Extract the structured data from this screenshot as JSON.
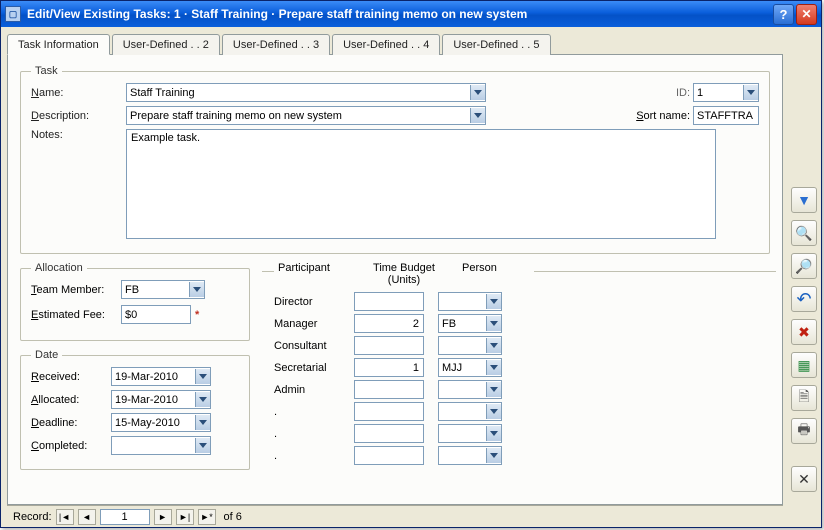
{
  "window": {
    "title": "Edit/View Existing Tasks:   1  ·  Staff Training  ·  Prepare staff training memo on new system"
  },
  "tabs": {
    "t0": "Task Information",
    "t1": "User-Defined . . 2",
    "t2": "User-Defined . . 3",
    "t3": "User-Defined . . 4",
    "t4": "User-Defined . . 5"
  },
  "task": {
    "legend": "Task",
    "name_label_u": "N",
    "name_label_rest": "ame:",
    "name_value": "Staff Training",
    "id_label": "ID:",
    "id_value": "1",
    "desc_label_u": "D",
    "desc_label_rest": "escription:",
    "desc_value": "Prepare staff training memo on new system",
    "sortname_label_u": "S",
    "sortname_label_rest": "ort name:",
    "sortname_value": "STAFFTRA",
    "notes_label": "Notes:",
    "notes_value": "Example task."
  },
  "allocation": {
    "legend": "Allocation",
    "team_label_u": "T",
    "team_label_rest": "eam Member:",
    "team_value": "FB",
    "fee_label_u": "E",
    "fee_label_rest": "stimated Fee:",
    "fee_value": "$0"
  },
  "dates": {
    "legend": "Date",
    "received_u": "R",
    "received_rest": "eceived:",
    "received_value": "19-Mar-2010",
    "allocated_u": "A",
    "allocated_rest": "llocated:",
    "allocated_value": "19-Mar-2010",
    "deadline_u": "D",
    "deadline_rest": "eadline:",
    "deadline_value": "15-May-2010",
    "completed_u": "C",
    "completed_rest": "ompleted:",
    "completed_value": ""
  },
  "participants": {
    "h1": "Participant",
    "h2": "Time Budget (Units)",
    "h3": "Person",
    "rows": {
      "0": {
        "label": "Director",
        "budget": "",
        "person": ""
      },
      "1": {
        "label": "Manager",
        "budget": "2",
        "person": "FB"
      },
      "2": {
        "label": "Consultant",
        "budget": "",
        "person": ""
      },
      "3": {
        "label": "Secretarial",
        "budget": "1",
        "person": "MJJ"
      },
      "4": {
        "label": "Admin",
        "budget": "",
        "person": ""
      },
      "5": {
        "label": ".",
        "budget": "",
        "person": ""
      },
      "6": {
        "label": ".",
        "budget": "",
        "person": ""
      },
      "7": {
        "label": ".",
        "budget": "",
        "person": ""
      }
    }
  },
  "toolbar_icons": {
    "filter": "▼",
    "find": "🔍",
    "zoom": "🔎",
    "undo": "↶",
    "delete": "✖",
    "sheet": "▦",
    "preview": "🗎",
    "print": "🖶",
    "close": "✕"
  },
  "status": {
    "label": "Record:",
    "first": "|◄",
    "prev": "◄",
    "current": "1",
    "next": "►",
    "last": "►|",
    "new": "►*",
    "of_text": "of  6"
  }
}
